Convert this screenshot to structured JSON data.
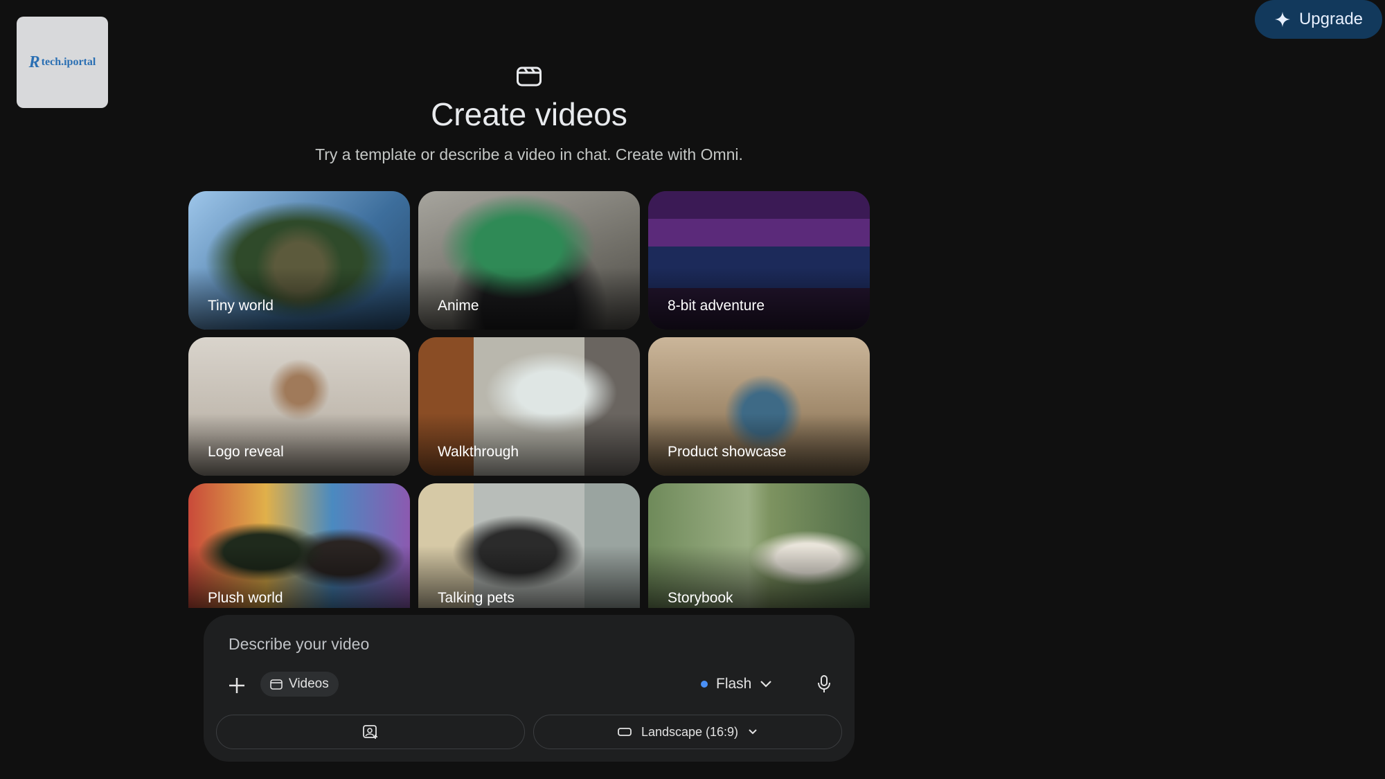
{
  "logo": {
    "text": "tech.iportal"
  },
  "header": {
    "upgrade_label": "Upgrade",
    "title": "Create videos",
    "subtitle": "Try a template or describe a video in chat. Create with Omni."
  },
  "templates": [
    {
      "label": "Tiny world"
    },
    {
      "label": "Anime"
    },
    {
      "label": "8-bit adventure"
    },
    {
      "label": "Logo reveal"
    },
    {
      "label": "Walkthrough"
    },
    {
      "label": "Product showcase"
    },
    {
      "label": "Plush world"
    },
    {
      "label": "Talking pets"
    },
    {
      "label": "Storybook"
    }
  ],
  "composer": {
    "placeholder": "Describe your video",
    "chip_label": "Videos",
    "model_label": "Flash",
    "aspect_label": "Landscape (16:9)"
  },
  "colors": {
    "background": "#101010",
    "composer": "#1e1f20",
    "accent_dot": "#4a90f6",
    "upgrade_bg": "#12395c"
  },
  "icons": [
    "sparkle-icon",
    "clapperboard-icon",
    "plus-icon",
    "video-chip-icon",
    "chevron-down-icon",
    "microphone-icon",
    "image-add-icon",
    "landscape-aspect-icon"
  ]
}
